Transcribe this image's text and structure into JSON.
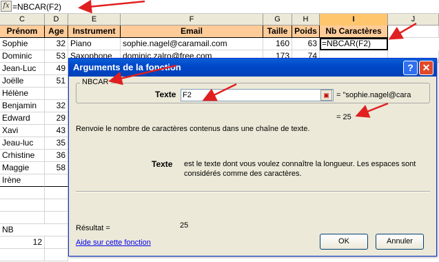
{
  "formula_bar": {
    "fx": "fx",
    "formula": "=NBCAR(F2)"
  },
  "columns": [
    "C",
    "D",
    "E",
    "F",
    "G",
    "H",
    "I",
    "J"
  ],
  "selected_column": "I",
  "headers": [
    "Prénom",
    "Age",
    "Instrument",
    "Email",
    "Taille",
    "Poids",
    "Nb Caractères"
  ],
  "row2": [
    "Sophie",
    "32",
    "Piano",
    "sophie.nagel@caramail.com",
    "160",
    "63",
    "=NBCAR(F2)"
  ],
  "row3": [
    "Dominic",
    "53",
    "Saxophone",
    "dominic.zalro@free.com",
    "173",
    "74"
  ],
  "names": [
    "Jean-Luc",
    "Joëlle",
    "Hélène",
    "Benjamin",
    "Edward",
    "Xavi",
    "Jeau-luc",
    "Crhistine",
    "Maggie",
    "Irène"
  ],
  "ages": [
    "49",
    "51",
    "",
    "32",
    "29",
    "43",
    "35",
    "36",
    "58",
    ""
  ],
  "nb_label": "NB",
  "nb_value": "12",
  "dialog": {
    "title": "Arguments de la fonction",
    "help_btn": "?",
    "close_btn": "✕",
    "group": "NBCAR",
    "texte_label": "Texte",
    "texte_value": "F2",
    "arg_value": "=  \"sophie.nagel@cara",
    "result_inline": "=  25",
    "description": "Renvoie le nombre de caractères contenus dans une chaîne de texte.",
    "arg_name": "Texte",
    "arg_desc": "est le texte dont vous voulez connaître la longueur. Les espaces sont considérés comme des caractères.",
    "result_label": "Résultat =",
    "result_value": "25",
    "help_link": "Aide sur cette fonction",
    "ok": "OK",
    "cancel": "Annuler"
  },
  "colors": {
    "header_fill": "#ffcc99",
    "selected_col": "#ffc66e",
    "title_bar": "#0048c8",
    "arrow": "#e02020"
  }
}
